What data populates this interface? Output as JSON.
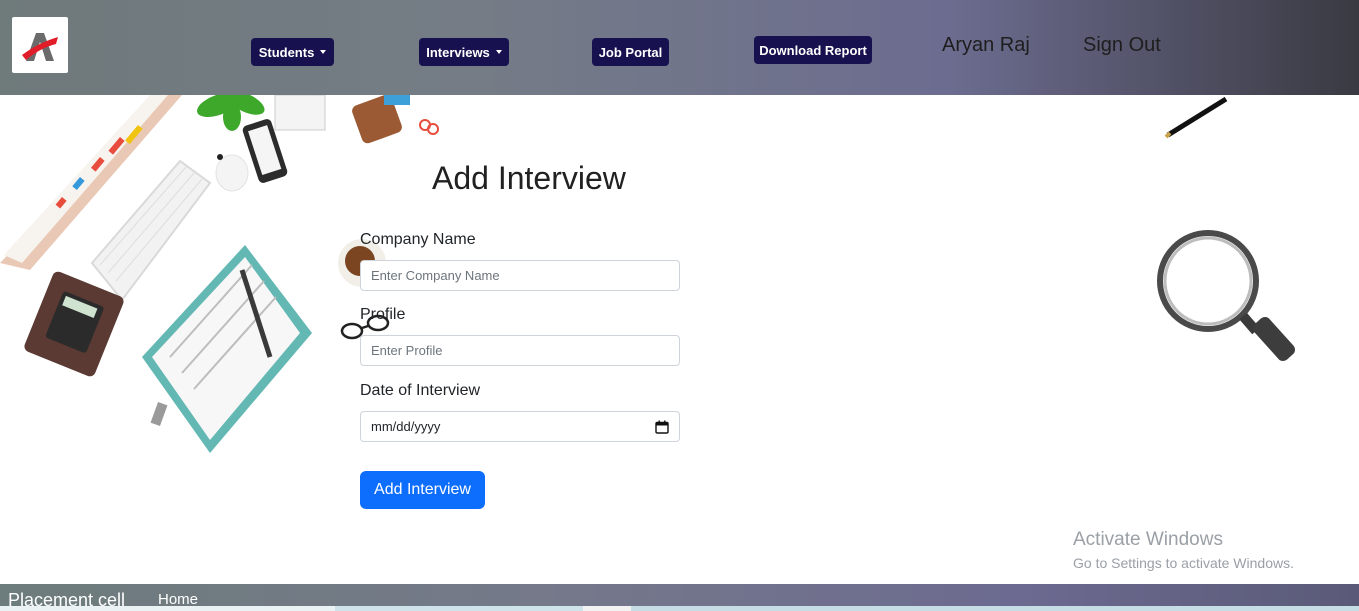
{
  "nav": {
    "students_label": "Students",
    "interviews_label": "Interviews",
    "job_portal_label": "Job Portal",
    "download_report_label": "Download Report",
    "user_name": "Aryan Raj",
    "sign_out_label": "Sign Out"
  },
  "form": {
    "title": "Add Interview",
    "company_label": "Company Name",
    "company_placeholder": "Enter Company Name",
    "company_value": "",
    "profile_label": "Profile",
    "profile_placeholder": "Enter Profile",
    "profile_value": "",
    "date_label": "Date of Interview",
    "date_placeholder": "mm/dd/yyyy",
    "submit_label": "Add Interview"
  },
  "watermark": {
    "title": "Activate Windows",
    "subtitle": "Go to Settings to activate Windows."
  },
  "footer": {
    "brand": "Placement cell",
    "home_label": "Home"
  },
  "colors": {
    "nav_button": "#17124f",
    "primary_button": "#0d6efd",
    "logo_red": "#e11d2a",
    "logo_gray": "#6b6b6b"
  },
  "icons": {
    "logo": "app-logo-icon",
    "dropdown": "caret-down-icon",
    "calendar": "calendar-icon"
  }
}
